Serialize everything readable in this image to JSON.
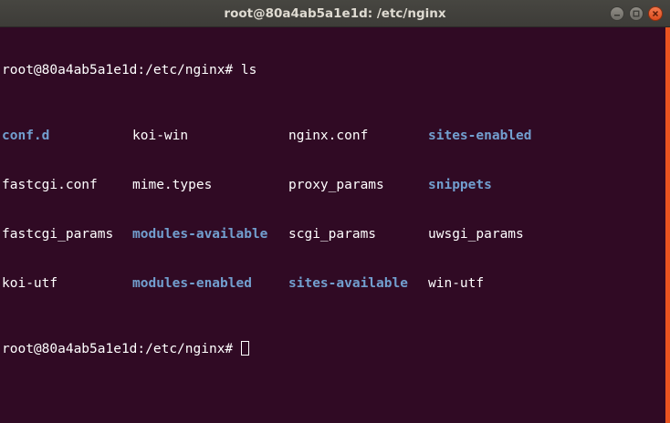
{
  "window": {
    "title": "root@80a4ab5a1e1d: /etc/nginx"
  },
  "terminal": {
    "prompt": "root@80a4ab5a1e1d:/etc/nginx#",
    "command": "ls",
    "listing": [
      [
        {
          "text": "conf.d",
          "type": "dir"
        },
        {
          "text": "koi-win",
          "type": "file"
        },
        {
          "text": "nginx.conf",
          "type": "file"
        },
        {
          "text": "sites-enabled",
          "type": "dir"
        }
      ],
      [
        {
          "text": "fastcgi.conf",
          "type": "file"
        },
        {
          "text": "mime.types",
          "type": "file"
        },
        {
          "text": "proxy_params",
          "type": "file"
        },
        {
          "text": "snippets",
          "type": "dir"
        }
      ],
      [
        {
          "text": "fastcgi_params",
          "type": "file"
        },
        {
          "text": "modules-available",
          "type": "dir"
        },
        {
          "text": "scgi_params",
          "type": "file"
        },
        {
          "text": "uwsgi_params",
          "type": "file"
        }
      ],
      [
        {
          "text": "koi-utf",
          "type": "file"
        },
        {
          "text": "modules-enabled",
          "type": "dir"
        },
        {
          "text": "sites-available",
          "type": "dir"
        },
        {
          "text": "win-utf",
          "type": "file"
        }
      ]
    ]
  },
  "colors": {
    "background": "#300a24",
    "directory": "#729fcf",
    "text": "#ffffff",
    "accent": "#e95420"
  },
  "icons": {
    "minimize": "minimize-icon",
    "maximize": "maximize-icon",
    "close": "close-icon"
  }
}
